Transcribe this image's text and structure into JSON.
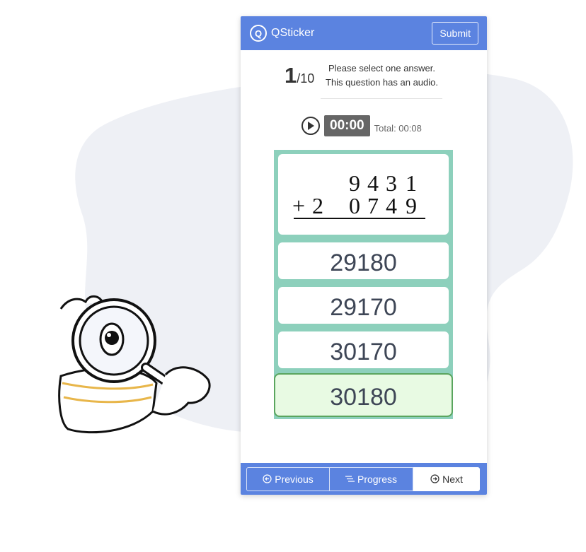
{
  "header": {
    "logo_letter": "Q",
    "brand": "QSticker",
    "submit_label": "Submit"
  },
  "question_info": {
    "current": "1",
    "total": "/10",
    "instruction": "Please select one answer.",
    "audio_note": "This question has an audio."
  },
  "audio": {
    "timer": "00:00",
    "total": "Total: 00:08"
  },
  "question": {
    "addend1": [
      "9",
      "4",
      "3",
      "1"
    ],
    "operator": "+",
    "addend2": [
      "2",
      "0",
      "7",
      "4",
      "9"
    ]
  },
  "options": [
    "29180",
    "29170",
    "30170",
    "30180"
  ],
  "selected_index": 3,
  "footer": {
    "previous_label": "Previous",
    "progress_label": "Progress",
    "next_label": "Next"
  },
  "colors": {
    "header": "#5b83e0",
    "quiz_bg": "#8dd0bc",
    "selected_bg": "#e8fae3",
    "selected_border": "#5aa55e",
    "blob": "#eef0f5"
  }
}
